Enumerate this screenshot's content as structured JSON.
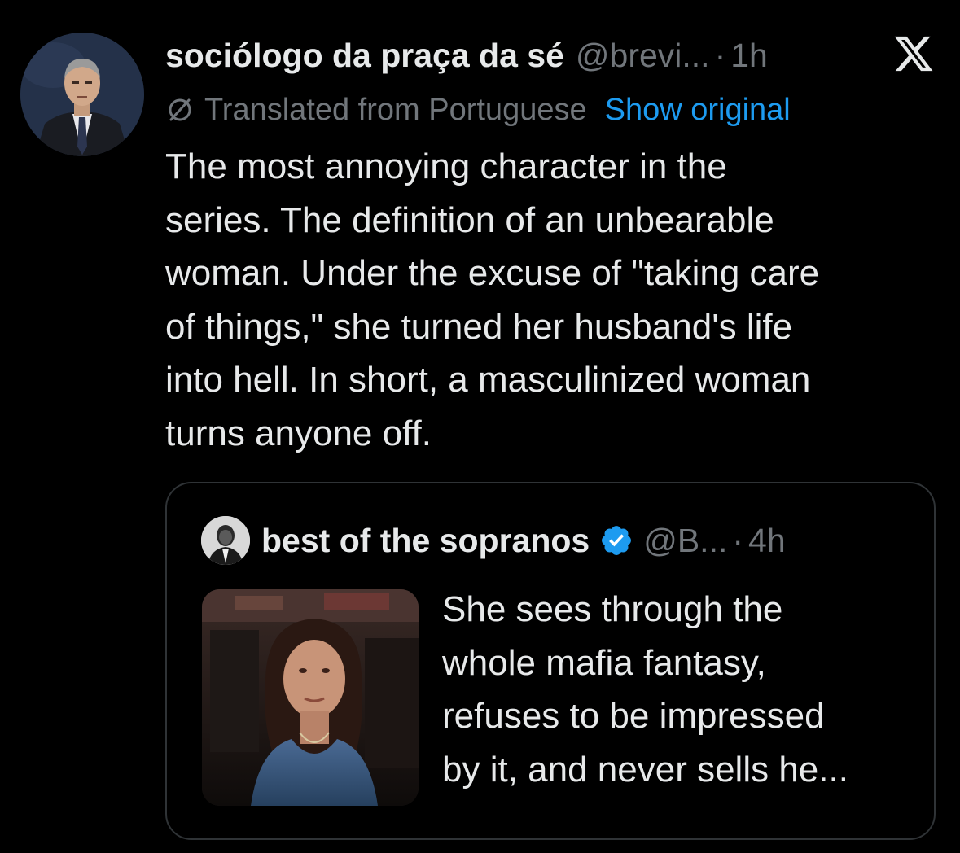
{
  "tweet": {
    "display_name": "sociólogo da praça da sé",
    "handle": "@brevi...",
    "separator": "·",
    "time": "1h",
    "translated_label": "Translated from Portuguese",
    "show_original": "Show original",
    "body_lines": [
      "The most annoying character in the",
      "series. The definition of an unbearable",
      "woman. Under the excuse of \"taking care",
      "of things,\" she turned her husband's life",
      "into hell. In short, a masculinized woman",
      "turns anyone off."
    ]
  },
  "quote": {
    "display_name": "best of the sopranos",
    "handle": "@B...",
    "separator": "·",
    "time": "4h",
    "text_lines": [
      "She sees through the",
      "whole mafia fantasy,",
      "refuses to be impressed",
      "by it, and never sells he..."
    ]
  },
  "colors": {
    "background": "#000000",
    "text_primary": "#e7e9ea",
    "text_secondary": "#71767b",
    "link": "#1d9bf0",
    "verified": "#1d9bf0",
    "border": "#2f3336"
  },
  "icons": {
    "brand": "x-logo-icon",
    "translate": "translate-icon",
    "verified": "verified-badge-icon"
  }
}
